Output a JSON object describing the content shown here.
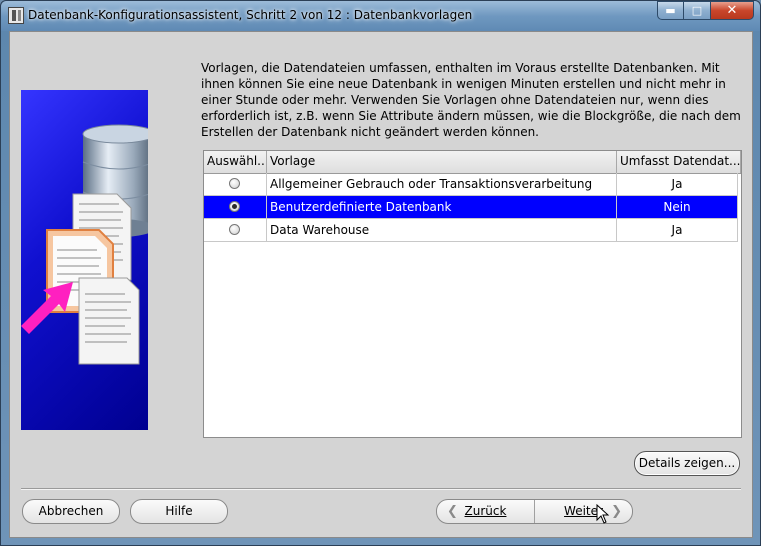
{
  "window": {
    "title": "Datenbank-Konfigurationsassistent, Schritt 2 von 12 : Datenbankvorlagen",
    "controls": {
      "minimize": "▬",
      "maximize": "□",
      "close": "✕"
    }
  },
  "description": "Vorlagen, die Datendateien umfassen, enthalten im Voraus erstellte Datenbanken. Mit ihnen können Sie eine neue Datenbank in wenigen Minuten erstellen und nicht mehr in einer Stunde oder mehr. Verwenden Sie Vorlagen ohne Datendateien nur, wenn dies erforderlich ist, z.B. wenn Sie Attribute ändern müssen, wie die Blockgröße, die nach dem Erstellen der Datenbank nicht geändert werden können.",
  "table": {
    "columns": [
      "Auswähl...",
      "Vorlage",
      "Umfasst Datendat..."
    ],
    "rows": [
      {
        "selected": false,
        "template": "Allgemeiner Gebrauch oder Transaktionsverarbeitung",
        "includes": "Ja"
      },
      {
        "selected": true,
        "template": "Benutzerdefinierte Datenbank",
        "includes": "Nein"
      },
      {
        "selected": false,
        "template": "Data Warehouse",
        "includes": "Ja"
      }
    ]
  },
  "buttons": {
    "details": "Details zeigen...",
    "cancel": "Abbrechen",
    "help": "Hilfe",
    "back": "Zurück",
    "next": "Weiter"
  },
  "icons": {
    "back_arrow": "❮",
    "next_arrow": "❯",
    "illustration": "database-documents-illustration"
  },
  "colors": {
    "selection": "#0000ff",
    "illustration_bg": "#1010d0",
    "arrow_accent": "#ff20c0"
  }
}
